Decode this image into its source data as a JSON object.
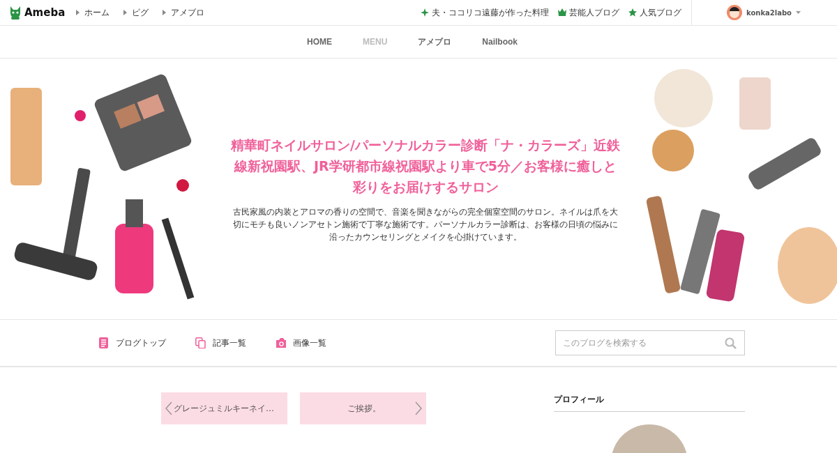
{
  "header": {
    "logo": "Ameba",
    "links": [
      "ホーム",
      "ピグ",
      "アメブロ"
    ],
    "promos": [
      {
        "kind": "sparkle",
        "label": "夫・ココリコ遠藤が作った料理"
      },
      {
        "kind": "crown",
        "label": "芸能人ブログ"
      },
      {
        "kind": "star",
        "label": "人気ブログ"
      }
    ],
    "user": "konka2labo"
  },
  "nav": [
    {
      "label": "HOME",
      "selected": false
    },
    {
      "label": "MENU",
      "selected": true
    },
    {
      "label": "アメブロ",
      "selected": false
    },
    {
      "label": "Nailbook",
      "selected": false
    }
  ],
  "hero": {
    "title": "精華町ネイルサロン/パーソナルカラー診断「ナ・カラーズ」近鉄線新祝園駅、JR学研都市線祝園駅より車で5分／お客様に癒しと彩りをお届けするサロン",
    "description": "古民家風の内装とアロマの香りの空間で、音楽を聞きながらの完全個室空間のサロン。ネイルは爪を大切にモチも良いノンアセトン施術で丁寧な施術です。パーソナルカラー診断は、お客様の日頃の悩みに沿ったカウンセリングとメイクを心掛けています。"
  },
  "menu": [
    {
      "kind": "document",
      "label": "ブログトップ"
    },
    {
      "kind": "copies",
      "label": "記事一覧"
    },
    {
      "kind": "camera",
      "label": "画像一覧"
    }
  ],
  "search": {
    "placeholder": "このブログを検索する"
  },
  "pager": {
    "previous": "グレージュミルキーネイ…",
    "next": "ご挨拶。"
  },
  "sidebar": {
    "heading": "プロフィール"
  }
}
